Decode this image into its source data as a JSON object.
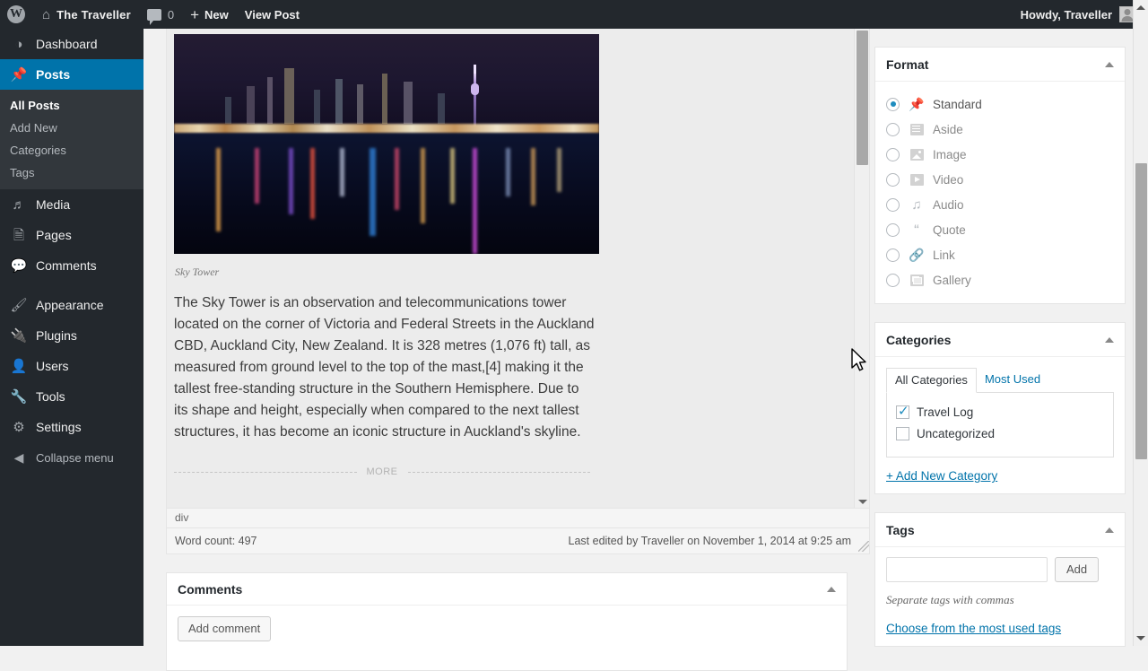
{
  "adminbar": {
    "wp_logo": "wordpress-logo",
    "site_name": "The Traveller",
    "comment_count": "0",
    "new_label": "New",
    "view_post_label": "View Post",
    "howdy": "Howdy, Traveller"
  },
  "sidebar": {
    "items": [
      {
        "label": "Dashboard",
        "icon": "dashboard-icon",
        "current": false
      },
      {
        "label": "Posts",
        "icon": "pin-icon",
        "current": true
      },
      {
        "label": "Media",
        "icon": "media-icon",
        "current": false
      },
      {
        "label": "Pages",
        "icon": "pages-icon",
        "current": false
      },
      {
        "label": "Comments",
        "icon": "comment-icon",
        "current": false
      },
      {
        "label": "Appearance",
        "icon": "appearance-icon",
        "current": false
      },
      {
        "label": "Plugins",
        "icon": "plugin-icon",
        "current": false
      },
      {
        "label": "Users",
        "icon": "users-icon",
        "current": false
      },
      {
        "label": "Tools",
        "icon": "tools-icon",
        "current": false
      },
      {
        "label": "Settings",
        "icon": "settings-icon",
        "current": false
      }
    ],
    "submenu": [
      "All Posts",
      "Add New",
      "Categories",
      "Tags"
    ],
    "collapse": "Collapse menu"
  },
  "editor": {
    "image_caption": "Sky Tower",
    "body": "The Sky Tower is an observation and telecommunications tower located on the corner of Victoria and Federal Streets in the Auckland CBD, Auckland City, New Zealand. It is 328 metres (1,076 ft) tall, as measured from ground level to the top of the mast,[4] making it the tallest free-standing structure in the Southern Hemisphere. Due to its shape and height, especially when compared to the next tallest structures, it has become an iconic structure in Auckland's skyline.",
    "more_label": "MORE",
    "path": "div",
    "word_count": "Word count: 497",
    "last_edited": "Last edited by Traveller on November 1, 2014 at 9:25 am"
  },
  "comments_box": {
    "title": "Comments",
    "add_comment": "Add comment"
  },
  "format_box": {
    "title": "Format",
    "options": [
      {
        "label": "Standard",
        "icon": "pin-icon",
        "selected": true
      },
      {
        "label": "Aside",
        "icon": "aside-icon",
        "selected": false
      },
      {
        "label": "Image",
        "icon": "image-icon",
        "selected": false
      },
      {
        "label": "Video",
        "icon": "video-icon",
        "selected": false
      },
      {
        "label": "Audio",
        "icon": "audio-icon",
        "selected": false
      },
      {
        "label": "Quote",
        "icon": "quote-icon",
        "selected": false
      },
      {
        "label": "Link",
        "icon": "link-icon",
        "selected": false
      },
      {
        "label": "Gallery",
        "icon": "gallery-icon",
        "selected": false
      }
    ]
  },
  "categories_box": {
    "title": "Categories",
    "tabs": [
      "All Categories",
      "Most Used"
    ],
    "active_tab": "All Categories",
    "items": [
      {
        "label": "Travel Log",
        "checked": true
      },
      {
        "label": "Uncategorized",
        "checked": false
      }
    ],
    "add_new": "+ Add New Category"
  },
  "tags_box": {
    "title": "Tags",
    "input_value": "",
    "input_placeholder": "",
    "add_label": "Add",
    "hint": "Separate tags with commas",
    "most_used_link": "Choose from the most used tags"
  },
  "colors": {
    "admin_bar": "#23282d",
    "menu_bg": "#23282d",
    "current_menu": "#0073aa",
    "accent_link": "#0073aa",
    "page_bg": "#f1f1f1"
  }
}
